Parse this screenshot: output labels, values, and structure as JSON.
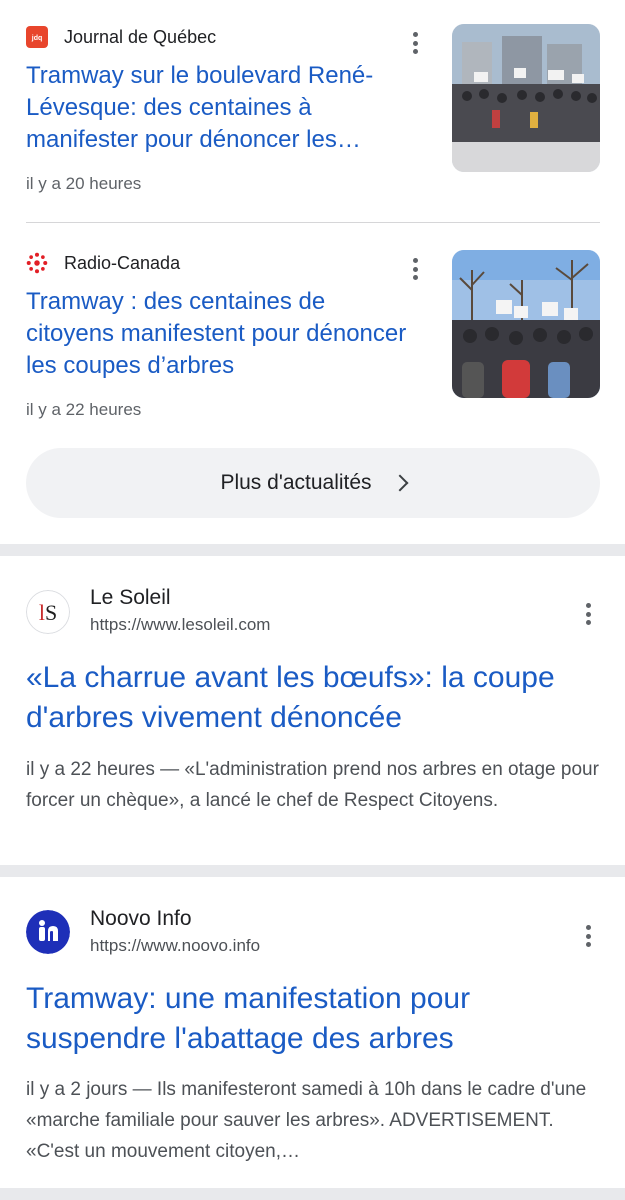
{
  "news": [
    {
      "source": "Journal de Québec",
      "favicon": "journal-de-quebec-logo-icon",
      "title": "Tramway sur le boulevard René-Lévesque: des centaines à manifester pour dénoncer les…",
      "time": "il y a 20 heures",
      "thumb": "protest-street-photo"
    },
    {
      "source": "Radio-Canada",
      "favicon": "radio-canada-logo-icon",
      "title": "Tramway : des centaines de citoyens manifestent pour dénoncer les coupes d’arbres",
      "time": "il y a 22 heures",
      "thumb": "protest-crowd-photo"
    }
  ],
  "more_news": {
    "label": "Plus d'actualités"
  },
  "results": [
    {
      "site_name": "Le Soleil",
      "site_url": "https://www.lesoleil.com",
      "site_logo_text": "lS",
      "title": "«La charrue avant les bœufs»: la coupe d'arbres vivement dénoncée",
      "snippet": "il y a 22 heures — «L'administration prend nos arbres en otage pour forcer un chèque», a lancé le chef de Respect Citoyens."
    },
    {
      "site_name": "Noovo Info",
      "site_url": "https://www.noovo.info",
      "title": "Tramway: une manifestation pour suspendre l'abattage des arbres",
      "snippet": "il y a 2 jours — Ils manifesteront samedi à 10h dans le cadre d'une «marche familiale pour sauver les arbres». ADVERTISEMENT. «C'est un mouvement citoyen,…"
    }
  ],
  "colors": {
    "link": "#1a5bc4",
    "separator": "#e8e9ec",
    "button_bg": "#f1f2f4"
  }
}
